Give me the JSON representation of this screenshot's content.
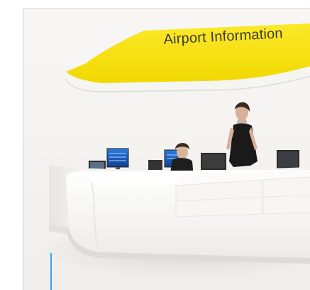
{
  "image": {
    "sign": {
      "label": "Airport Information",
      "color": "#f7e21b"
    },
    "accent_color": "#3aa7e6",
    "icons": [
      "airport-information-desk",
      "information-sign",
      "receptionist",
      "agent",
      "monitor"
    ]
  }
}
